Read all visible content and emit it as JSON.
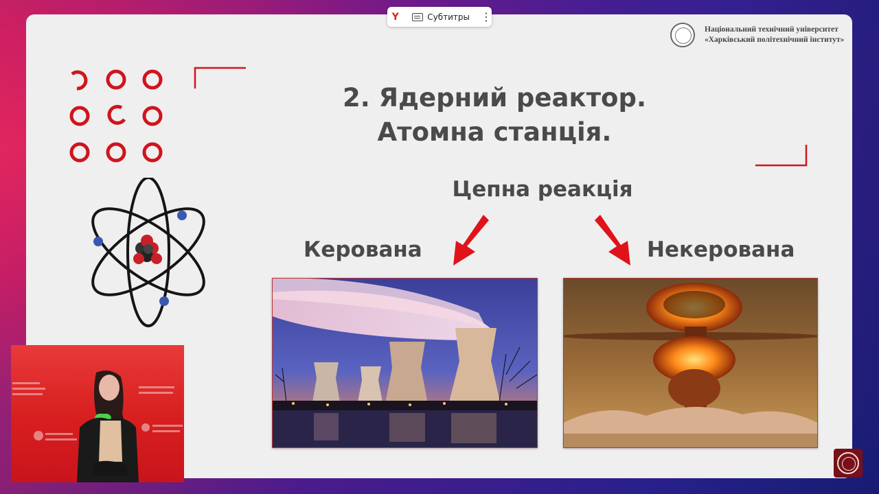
{
  "subtitles_bar": {
    "browser_icon": "yandex-logo-icon",
    "label": "Субтитры",
    "menu_icon": "more-vertical-icon"
  },
  "university": {
    "line1": "Національний технічний університет",
    "line2": "«Харківський політехнічний інститут»"
  },
  "slide": {
    "title_line1": "2. Ядерний реактор.",
    "title_line2": "Атомна станція.",
    "chain_reaction": "Цепна реакція",
    "controlled": "Керована",
    "uncontrolled": "Некерована"
  },
  "colors": {
    "accent_red": "#d0141c",
    "text_gray": "#4a4a4a",
    "slide_bg": "#efefef"
  }
}
